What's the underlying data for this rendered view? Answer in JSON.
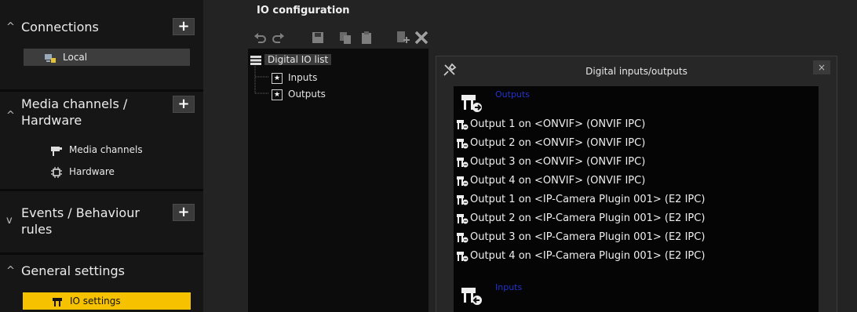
{
  "sidebar": {
    "sections": [
      {
        "title": "Connections",
        "collapse_icon": "chevron-up-icon",
        "add_label": "+",
        "items": [
          {
            "label": "Local",
            "icon": "network-server-icon",
            "selected": true
          }
        ]
      },
      {
        "title": "Media channels / Hardware",
        "collapse_icon": "chevron-up-icon",
        "add_label": "+",
        "items": [
          {
            "label": "Media channels",
            "icon": "camera-icon"
          },
          {
            "label": "Hardware",
            "icon": "chip-icon"
          }
        ]
      },
      {
        "title": "Events / Behaviour rules",
        "collapse_icon": "chevron-down-icon",
        "add_label": "+",
        "items": []
      },
      {
        "title": "General settings",
        "collapse_icon": "chevron-up-icon",
        "items": [
          {
            "label": "IO settings",
            "icon": "io-plug-icon",
            "selected": true,
            "highlight": "#f6c200"
          }
        ]
      }
    ]
  },
  "main": {
    "title": "IO configuration",
    "toolbar": [
      "undo-icon",
      "redo-icon",
      "save-icon",
      "copy-icon",
      "paste-icon",
      "add-icon",
      "delete-icon"
    ],
    "tree": {
      "root": "Digital IO list",
      "children": [
        "Inputs",
        "Outputs"
      ]
    }
  },
  "dialog": {
    "title": "Digital inputs/outputs",
    "close_label": "×",
    "groups": [
      {
        "name": "Outputs",
        "icon": "output-plug-icon",
        "items": [
          "Output 1 on <ONVIF> (ONVIF IPC)",
          "Output 2 on <ONVIF> (ONVIF IPC)",
          "Output 3 on <ONVIF> (ONVIF IPC)",
          "Output 4 on <ONVIF> (ONVIF IPC)",
          "Output 1 on <IP-Camera Plugin 001> (E2 IPC)",
          "Output 2 on <IP-Camera Plugin 001> (E2 IPC)",
          "Output 3 on <IP-Camera Plugin 001> (E2 IPC)",
          "Output 4 on <IP-Camera Plugin 001> (E2 IPC)"
        ]
      },
      {
        "name": "Inputs",
        "icon": "input-plug-icon",
        "items": []
      }
    ]
  },
  "colors": {
    "accent_yellow": "#f6c200",
    "group_label_blue": "#2233cc",
    "background": "#232323"
  }
}
